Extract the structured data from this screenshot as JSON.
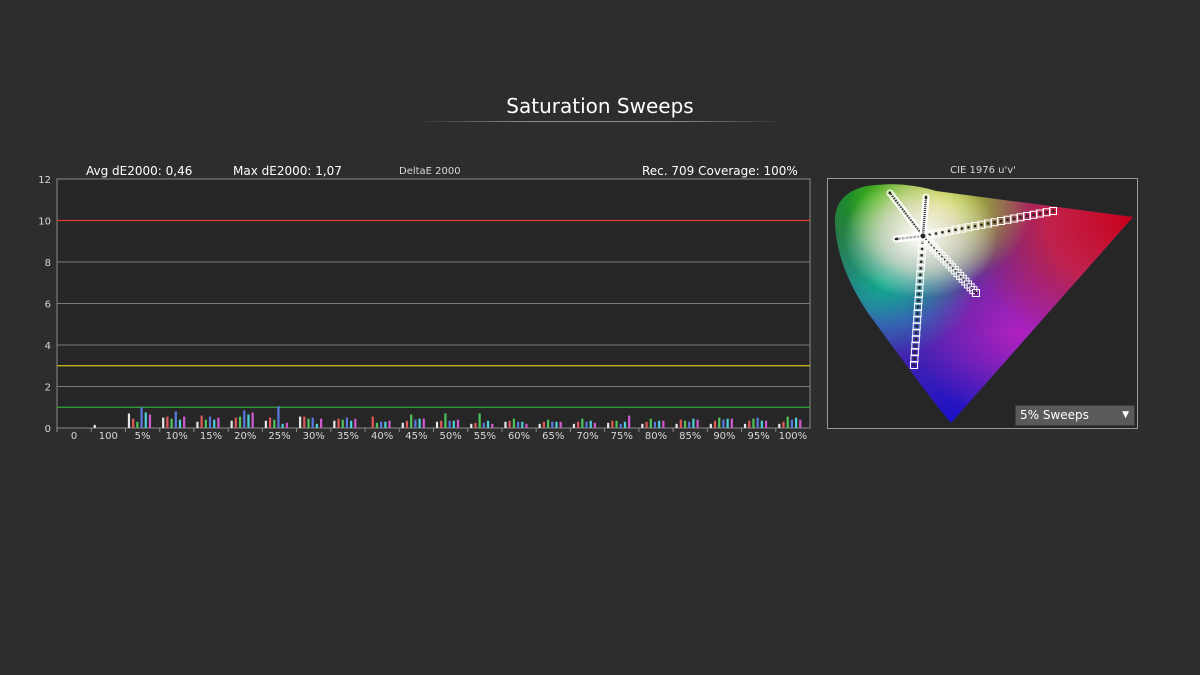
{
  "page": {
    "title": "Saturation Sweeps",
    "avg": "Avg dE2000: 0,46",
    "max": "Max dE2000: 1,07",
    "metric": "DeltaE 2000",
    "coverage": "Rec. 709 Coverage: 100%"
  },
  "chart_data": {
    "type": "bar",
    "ylim": [
      0,
      12
    ],
    "yticks": [
      "0",
      "2",
      "4",
      "6",
      "8",
      "10",
      "12"
    ],
    "thresholds": [
      {
        "value": 10,
        "color": "#e23a2e"
      },
      {
        "value": 3,
        "color": "#d6c21a"
      },
      {
        "value": 1,
        "color": "#2fa83a"
      }
    ],
    "series_colors": [
      "#e6e6e6",
      "#e05a5a",
      "#52c35a",
      "#5a7ae0",
      "#4fd0d8",
      "#d05ad0",
      "#e0d04a"
    ],
    "categories": [
      "0",
      "100",
      "5%",
      "10%",
      "15%",
      "20%",
      "25%",
      "30%",
      "35%",
      "40%",
      "45%",
      "50%",
      "55%",
      "60%",
      "65%",
      "70%",
      "75%",
      "80%",
      "85%",
      "90%",
      "95%",
      "100%"
    ],
    "groups": [
      {
        "label": "0",
        "values": [
          0,
          0,
          0,
          0,
          0,
          0,
          0
        ]
      },
      {
        "label": "100",
        "values": [
          0.15,
          0,
          0,
          0,
          0,
          0,
          0
        ]
      },
      {
        "label": "5%",
        "values": [
          0.7,
          0.45,
          0.3,
          1.0,
          0.75,
          0.65,
          0
        ]
      },
      {
        "label": "10%",
        "values": [
          0.5,
          0.55,
          0.45,
          0.8,
          0.4,
          0.55,
          0
        ]
      },
      {
        "label": "15%",
        "values": [
          0.3,
          0.6,
          0.4,
          0.55,
          0.4,
          0.5,
          0
        ]
      },
      {
        "label": "20%",
        "values": [
          0.35,
          0.5,
          0.55,
          0.85,
          0.65,
          0.75,
          0
        ]
      },
      {
        "label": "25%",
        "values": [
          0.35,
          0.5,
          0.4,
          1.05,
          0.2,
          0.25,
          0
        ]
      },
      {
        "label": "30%",
        "values": [
          0.55,
          0.55,
          0.45,
          0.5,
          0.2,
          0.45,
          0
        ]
      },
      {
        "label": "35%",
        "values": [
          0.35,
          0.45,
          0.4,
          0.5,
          0.35,
          0.45,
          0
        ]
      },
      {
        "label": "40%",
        "values": [
          0,
          0.55,
          0.25,
          0.3,
          0.3,
          0.35,
          0
        ]
      },
      {
        "label": "45%",
        "values": [
          0.25,
          0.35,
          0.65,
          0.4,
          0.45,
          0.45,
          0
        ]
      },
      {
        "label": "50%",
        "values": [
          0.3,
          0.35,
          0.7,
          0.35,
          0.35,
          0.4,
          0
        ]
      },
      {
        "label": "55%",
        "values": [
          0.2,
          0.25,
          0.7,
          0.25,
          0.35,
          0.2,
          0
        ]
      },
      {
        "label": "60%",
        "values": [
          0.3,
          0.35,
          0.45,
          0.3,
          0.3,
          0.2,
          0
        ]
      },
      {
        "label": "65%",
        "values": [
          0.2,
          0.3,
          0.4,
          0.3,
          0.3,
          0.3,
          0
        ]
      },
      {
        "label": "70%",
        "values": [
          0.2,
          0.3,
          0.45,
          0.3,
          0.35,
          0.25,
          0
        ]
      },
      {
        "label": "75%",
        "values": [
          0.25,
          0.35,
          0.35,
          0.2,
          0.3,
          0.6,
          0
        ]
      },
      {
        "label": "80%",
        "values": [
          0.2,
          0.3,
          0.45,
          0.3,
          0.35,
          0.35,
          0
        ]
      },
      {
        "label": "85%",
        "values": [
          0.2,
          0.4,
          0.35,
          0.3,
          0.45,
          0.4,
          0
        ]
      },
      {
        "label": "90%",
        "values": [
          0.2,
          0.35,
          0.5,
          0.4,
          0.45,
          0.45,
          0
        ]
      },
      {
        "label": "95%",
        "values": [
          0.2,
          0.35,
          0.45,
          0.5,
          0.35,
          0.35,
          0
        ]
      },
      {
        "label": "100%",
        "values": [
          0.2,
          0.3,
          0.55,
          0.4,
          0.5,
          0.4,
          0
        ]
      }
    ]
  },
  "cie": {
    "title": "CIE 1976 u'v'",
    "dropdown": "5% Sweeps"
  }
}
